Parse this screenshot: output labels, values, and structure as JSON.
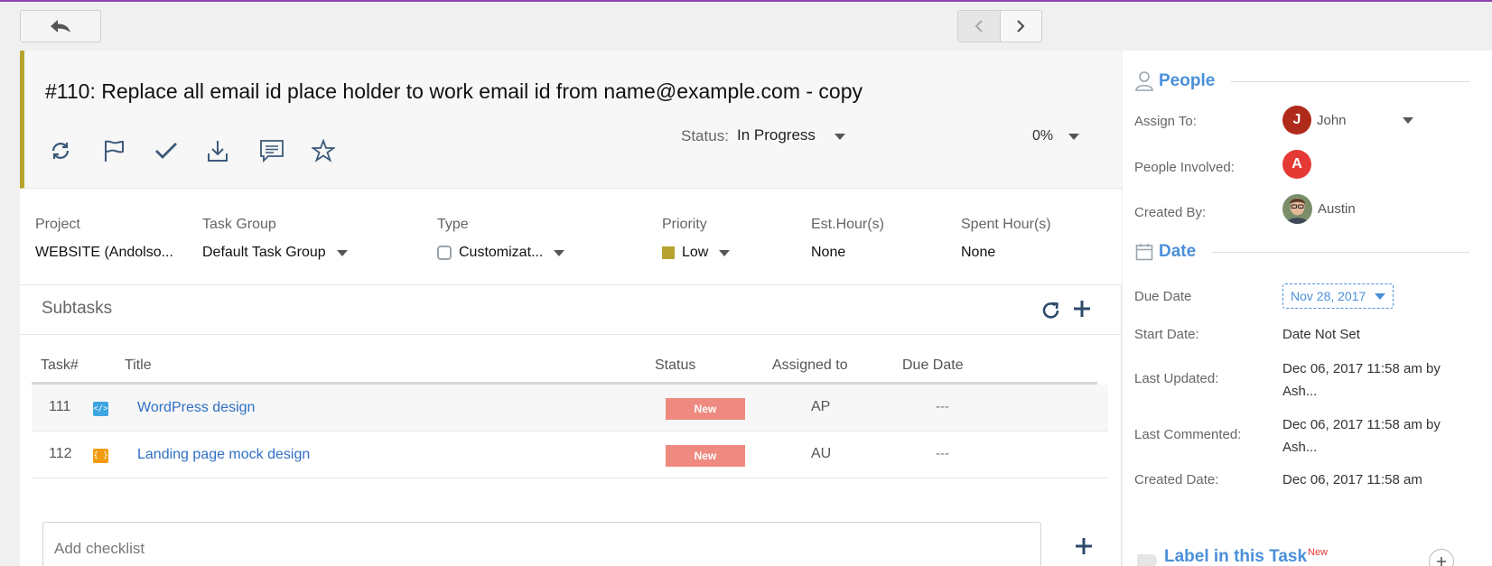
{
  "nav": {
    "back_icon": "reply-arrow-icon",
    "prev_icon": "chevron-left-icon",
    "next_icon": "chevron-right-icon"
  },
  "task": {
    "title": "#110: Replace all email id place holder to work email id from name@example.com - copy",
    "status_label": "Status:",
    "status_value": "In Progress",
    "progress_label": "0%",
    "progress": 0,
    "actions": [
      "refresh-icon",
      "flag-icon",
      "check-icon",
      "download-icon",
      "comment-icon",
      "star-icon"
    ]
  },
  "fields": {
    "project": {
      "label": "Project",
      "value": "WEBSITE (Andolso..."
    },
    "task_group": {
      "label": "Task Group",
      "value": "Default Task Group"
    },
    "type": {
      "label": "Type",
      "value": "Customizat..."
    },
    "priority": {
      "label": "Priority",
      "value": "Low",
      "color": "#b7a42f"
    },
    "est_hours": {
      "label": "Est.Hour(s)",
      "value": "None"
    },
    "spent_hours": {
      "label": "Spent Hour(s)",
      "value": "None"
    }
  },
  "subtasks": {
    "title": "Subtasks",
    "headers": {
      "num": "Task#",
      "title": "Title",
      "status": "Status",
      "assigned": "Assigned to",
      "due": "Due Date"
    },
    "rows": [
      {
        "num": "111",
        "icon": "code-icon",
        "icon_glyph": "</>",
        "icon_color": "#3da5e0",
        "title": "WordPress design",
        "status": "New",
        "assigned": "AP",
        "due": "---"
      },
      {
        "num": "112",
        "icon": "design-icon",
        "icon_glyph": "{ }",
        "icon_color": "#f39c12",
        "title": "Landing page mock design",
        "status": "New",
        "assigned": "AU",
        "due": "---"
      }
    ],
    "status_color": "#ef8a80"
  },
  "checklist": {
    "placeholder": "Add checklist"
  },
  "people": {
    "title": "People",
    "assign_to": {
      "label": "Assign To:",
      "initial": "J",
      "name": "John",
      "color": "#b02a1a"
    },
    "involved": {
      "label": "People Involved:",
      "initial": "A",
      "color": "#e53935"
    },
    "created_by": {
      "label": "Created By:",
      "name": "Austin"
    }
  },
  "date": {
    "title": "Date",
    "due": {
      "label": "Due Date",
      "value": "Nov 28, 2017"
    },
    "start": {
      "label": "Start Date:",
      "value": "Date Not Set"
    },
    "updated": {
      "label": "Last Updated:",
      "value": "Dec 06, 2017 11:58 am by Ash..."
    },
    "commented": {
      "label": "Last Commented:",
      "value": "Dec 06, 2017 11:58 am by Ash..."
    },
    "created": {
      "label": "Created Date:",
      "value": "Dec 06, 2017 11:58 am"
    }
  },
  "labels": {
    "title": "Label in this Task",
    "new_badge": "New"
  },
  "colors": {
    "accent": "#4a90d9",
    "header_border": "#b7a42f",
    "top_line": "#8e44ad",
    "link": "#2f6fc5"
  }
}
